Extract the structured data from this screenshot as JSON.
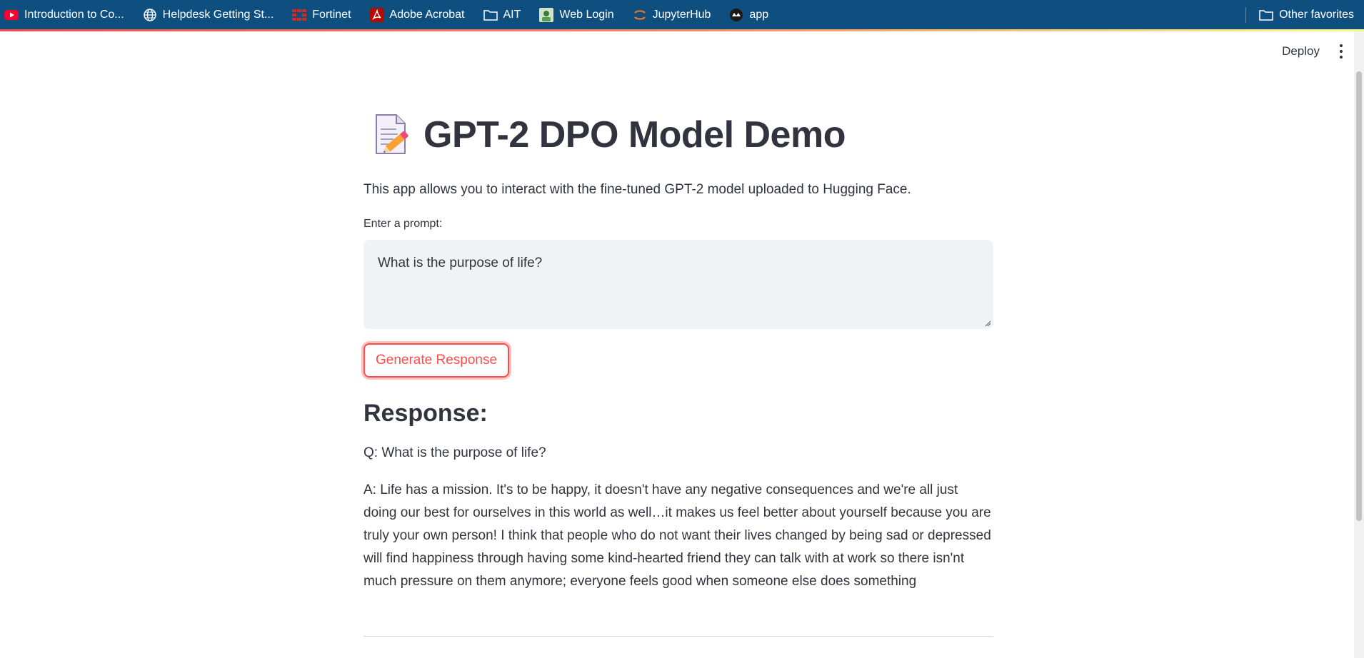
{
  "bookmarks": {
    "items": [
      {
        "label": "Introduction to Co...",
        "icon": "youtube-icon"
      },
      {
        "label": "Helpdesk Getting St...",
        "icon": "globe-icon"
      },
      {
        "label": "Fortinet",
        "icon": "fortinet-icon"
      },
      {
        "label": "Adobe Acrobat",
        "icon": "acrobat-icon"
      },
      {
        "label": "AIT",
        "icon": "folder-icon"
      },
      {
        "label": "Web Login",
        "icon": "web-login-icon"
      },
      {
        "label": "JupyterHub",
        "icon": "jupyter-icon"
      },
      {
        "label": "app",
        "icon": "streamlit-icon"
      }
    ],
    "other_favorites": "Other favorites"
  },
  "header": {
    "deploy_label": "Deploy"
  },
  "main": {
    "title": "GPT-2 DPO Model Demo",
    "title_emoji": "memo-icon",
    "intro": "This app allows you to interact with the fine-tuned GPT-2 model uploaded to Hugging Face.",
    "prompt_label": "Enter a prompt:",
    "prompt_value": "What is the purpose of life?",
    "button_label": "Generate Response",
    "response_heading": "Response:",
    "question": "Q: What is the purpose of life?",
    "answer": "A: Life has a mission. It's to be happy, it doesn't have any negative consequences and we're all just doing our best for ourselves in this world as well…it makes us feel better about yourself because you are truly your own person! I think that people who do not want their lives changed by being sad or depressed will find happiness through having some kind-hearted friend they can talk with at work so there isn'nt much pressure on them anymore; everyone feels good when someone else does something"
  },
  "colors": {
    "bookmarks_bg": "#0e4f80",
    "accent": "#ff4b4b",
    "text": "#31333f",
    "input_bg": "#f0f2f6"
  }
}
